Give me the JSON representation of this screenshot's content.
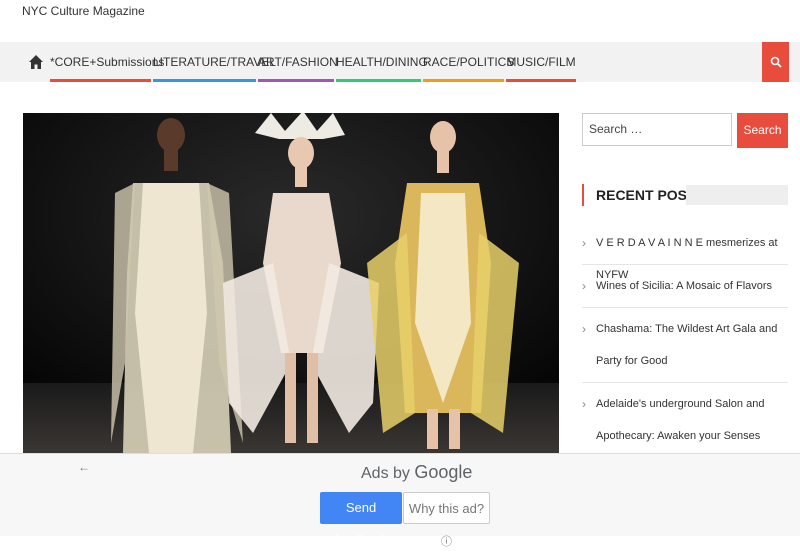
{
  "site": {
    "tagline": "NYC Culture Magazine"
  },
  "nav": {
    "home_icon": "home-icon",
    "items": [
      {
        "label": "*CORE+Submissions",
        "color": "#e74c3c"
      },
      {
        "label": "LITERATURE/TRAVEL",
        "color": "#3498db"
      },
      {
        "label": "ART/FASHION",
        "color": "#9b59b6"
      },
      {
        "label": "HEALTH/DINING",
        "color": "#2ecc71"
      },
      {
        "label": "RACE/POLITICS",
        "color": "#f39c12"
      },
      {
        "label": "MUSIC/FILM",
        "color": "#e74c3c"
      }
    ],
    "search_icon": "search-icon"
  },
  "sidebar": {
    "search": {
      "placeholder": "Search …",
      "button_label": "Search"
    },
    "recent_posts": {
      "heading": "RECENT POSTS",
      "posts": [
        {
          "title": "V E R D A V A I N N E mesmerizes at NYFW"
        },
        {
          "title": "Wines of Sicilia: A Mosaic of Flavors"
        },
        {
          "title": "Chashama: The Wildest Art Gala and Party for Good"
        },
        {
          "title": "Adelaide's underground Salon and Apothecary: Awaken your Senses"
        }
      ]
    }
  },
  "ads": {
    "back_icon": "arrow-left-icon",
    "title_prefix": "Ads by",
    "title_brand": "Google",
    "feedback_label": "Send feedback",
    "why_label": "Why this ad?",
    "info_icon": "info-icon"
  },
  "colors": {
    "accent": "#e74c3c",
    "google_blue": "#4285f4"
  }
}
